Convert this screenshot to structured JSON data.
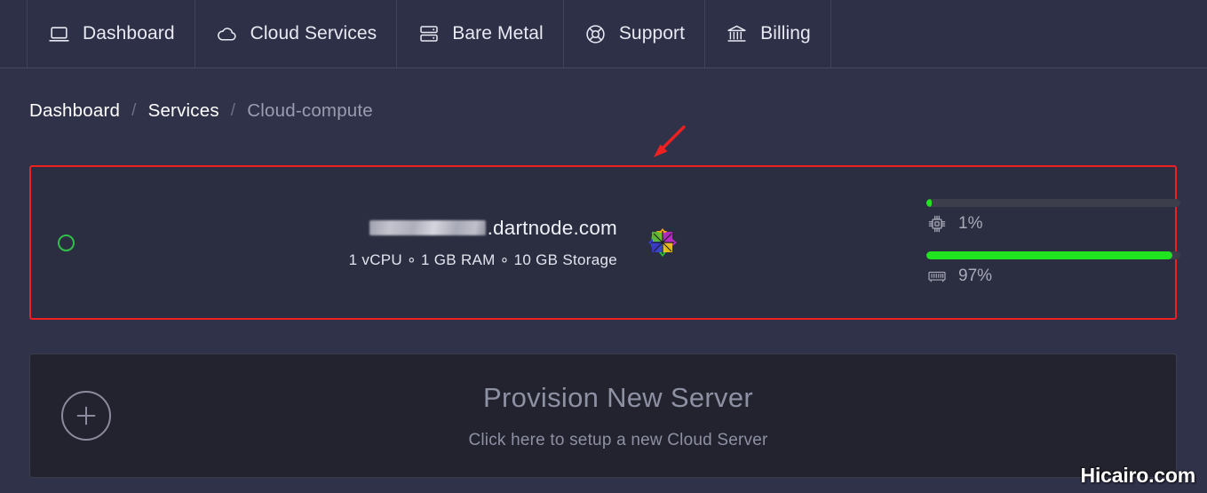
{
  "nav": {
    "items": [
      {
        "label": "Dashboard",
        "icon": "laptop-icon"
      },
      {
        "label": "Cloud Services",
        "icon": "cloud-icon"
      },
      {
        "label": "Bare Metal",
        "icon": "server-rack-icon"
      },
      {
        "label": "Support",
        "icon": "lifebuoy-icon"
      },
      {
        "label": "Billing",
        "icon": "bank-icon"
      }
    ]
  },
  "breadcrumb": {
    "separator": "/",
    "items": [
      {
        "label": "Dashboard",
        "current": false
      },
      {
        "label": "Services",
        "current": false
      },
      {
        "label": "Cloud-compute",
        "current": true
      }
    ]
  },
  "server_card": {
    "status": {
      "state": "running",
      "color": "#2fbf4a",
      "icon": "status-circle-icon"
    },
    "hostname_redacted": true,
    "hostname_suffix": ".dartnode.com",
    "specs": "1 vCPU ∘ 1 GB RAM ∘ 10 GB Storage",
    "os_icon": "pinwheel-os-icon",
    "highlight_color": "#ef2020",
    "metrics": [
      {
        "name": "cpu",
        "icon": "cpu-chip-icon",
        "value": 1,
        "label": "1%",
        "bar_color": "#21e421"
      },
      {
        "name": "memory",
        "icon": "ram-module-icon",
        "value": 97,
        "label": "97%",
        "bar_color": "#21e421"
      }
    ]
  },
  "annotation": {
    "arrow_color": "#ef2020",
    "icon": "red-arrow-icon"
  },
  "provision_card": {
    "icon": "plus-circle-icon",
    "title": "Provision New Server",
    "subtitle": "Click here to setup a new Cloud Server"
  },
  "watermark": {
    "text": "Hicairo.com"
  }
}
